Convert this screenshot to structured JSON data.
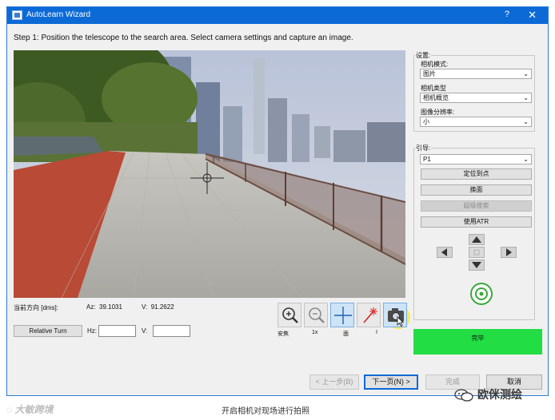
{
  "window": {
    "title": "AutoLearn Wizard",
    "help_glyph": "?",
    "close_glyph": "✕"
  },
  "step_text": "Step 1: Position the telescope to the search area. Select camera settings and capture an image.",
  "status": {
    "direction_label": "当前方向 [dms]:",
    "az_label": "Az:",
    "az_value": "39.1031",
    "v_label": "V:",
    "v_value": "91.2622"
  },
  "relative_turn": {
    "button_label": "Relative Turn",
    "hz_label": "Hz:",
    "v_label": "V:",
    "hz_value": "",
    "v_value": ""
  },
  "toolbar": {
    "tools": [
      {
        "icon": "zoom-in-icon",
        "caption": "安焦"
      },
      {
        "icon": "zoom-out-icon",
        "caption": "1x"
      },
      {
        "icon": "crosshair-icon",
        "caption": "面"
      },
      {
        "icon": "laser-icon",
        "caption": "I"
      },
      {
        "icon": "camera-icon",
        "caption": ""
      }
    ]
  },
  "settings": {
    "group_title": "设置:",
    "camera_mode_label": "相机模式:",
    "camera_mode_value": "图片",
    "camera_type_label": "相机类型",
    "camera_type_value": "相机概览",
    "resolution_label": "图像分辨率:",
    "resolution_value": "小"
  },
  "guide": {
    "group_title": "引导:",
    "point_value": "P1",
    "locate_button": "定位到点",
    "face_button": "换面",
    "super_search_button": "超级搜索",
    "atr_button": "使用ATR"
  },
  "done_label": "完毕",
  "footer": {
    "prev": "< 上一步(B)",
    "next": "下一页(N) >",
    "finish": "完成",
    "cancel": "取消"
  },
  "caption": "开启相机对现场进行拍照",
  "watermark_left": "大敏跨境",
  "watermark_right": "欧侎测绘",
  "colors": {
    "titlebar": "#0c6ad7",
    "done_green": "#22dd44",
    "highlight": "#f5e628"
  }
}
